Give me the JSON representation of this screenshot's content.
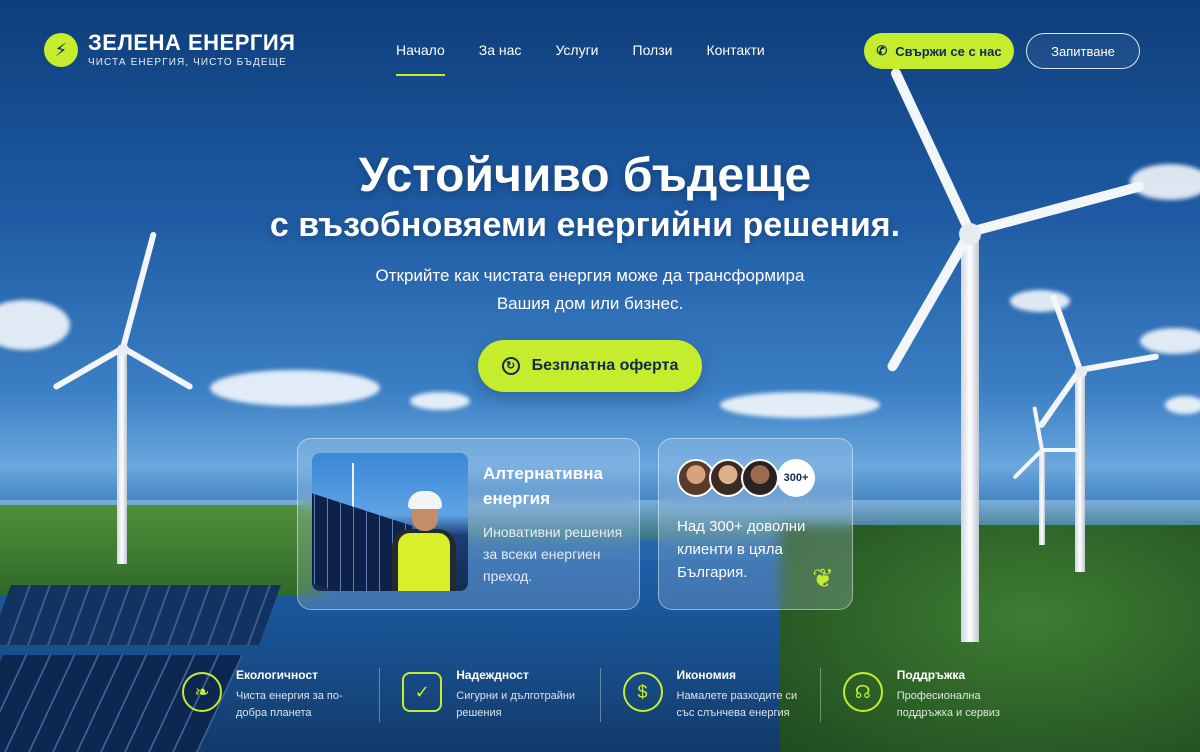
{
  "brand": {
    "name": "ЗЕЛЕНА ЕНЕРГИЯ",
    "tagline": "ЧИСТА ЕНЕРГИЯ, ЧИСТО БЪДЕЩЕ",
    "badge_icon": "lightning-icon"
  },
  "nav": {
    "items": [
      {
        "label": "Начало",
        "active": true
      },
      {
        "label": "За нас"
      },
      {
        "label": "Услуги"
      },
      {
        "label": "Ползи"
      },
      {
        "label": "Контакти"
      }
    ]
  },
  "header_buttons": {
    "contact_label": "Свържи се с нас",
    "contact_icon": "phone-icon",
    "inquiry_label": "Запитване"
  },
  "hero": {
    "title_line1": "Устойчиво бъдеще",
    "title_line2": "с възобновяеми енергийни решения.",
    "subtitle_line1": "Открийте как чистата енергия може да трансформира",
    "subtitle_line2": "Вашия дом или бизнес.",
    "cta_label": "Безплатна оферта"
  },
  "cards": {
    "alt_energy": {
      "title": "Алтернативна енергия",
      "text": "Иновативни решения за всеки енергиен преход."
    },
    "clients": {
      "count_badge": "300+",
      "text": "Над 300+ доволни клиенти в цяла България."
    }
  },
  "features": [
    {
      "icon": "eco-leaf-icon",
      "title": "Екологичност",
      "text": "Чиста енергия за по-добра планета"
    },
    {
      "icon": "shield-check-icon",
      "title": "Надеждност",
      "text": "Сигурни и дълготрайни решения"
    },
    {
      "icon": "piggy-bank-icon",
      "title": "Икономия",
      "text": "Намалете разходите си със слънчева енергия"
    },
    {
      "icon": "headset-icon",
      "title": "Поддръжка",
      "text": "Професионална поддръжка и сервиз"
    }
  ],
  "colors": {
    "accent": "#c6ec2e",
    "dark_text": "#0f2b4e",
    "sky_top": "#0e3e7a"
  }
}
